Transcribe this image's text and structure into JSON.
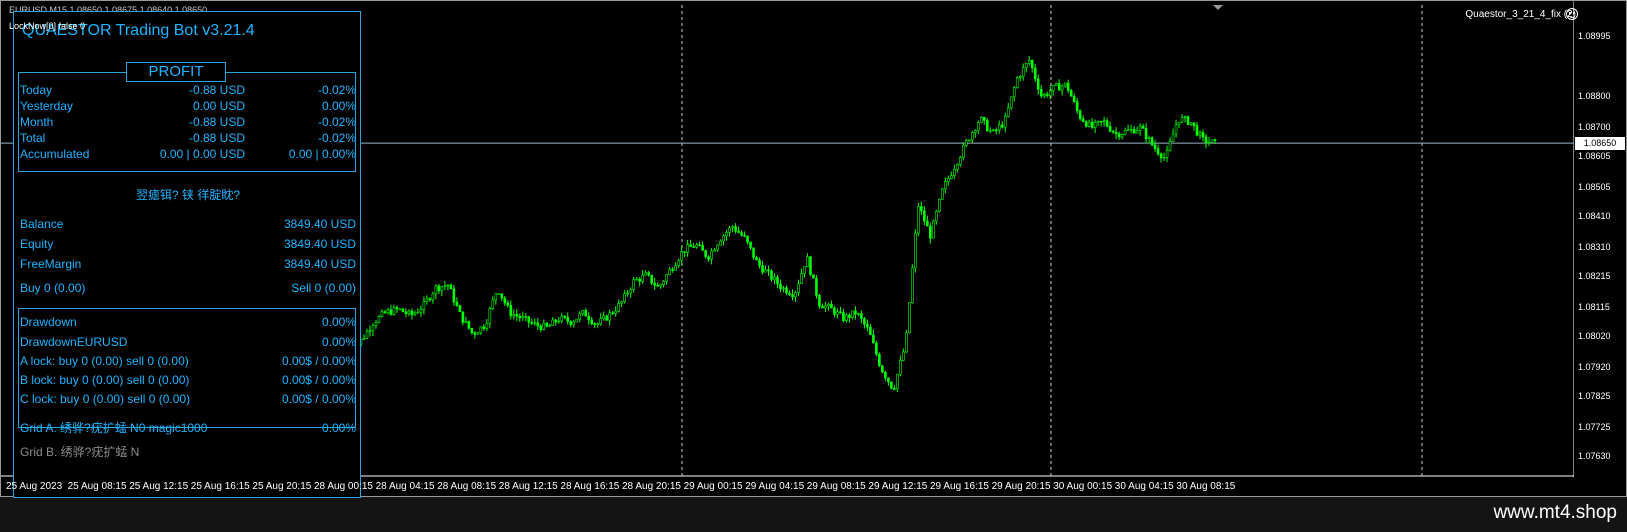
{
  "window": {
    "title_status": "EURUSD,M15 1.08650 1.08675 1.08640 1.08650",
    "lock_now": "LockNow[0] false 0",
    "expert": "Quaestor_3_21_4_fix (2)"
  },
  "panel": {
    "title": "QUAESTOR Trading Bot v3.21.4",
    "profit_header": "PROFIT",
    "profit_rows": [
      {
        "label": "Today",
        "usd": "-0.88 USD",
        "pct": "-0.02%"
      },
      {
        "label": "Yesterday",
        "usd": "0.00 USD",
        "pct": "0.00%"
      },
      {
        "label": "Month",
        "usd": "-0.88 USD",
        "pct": "-0.02%"
      },
      {
        "label": "Total",
        "usd": "-0.88 USD",
        "pct": "-0.02%"
      },
      {
        "label": "Accumulated",
        "usd": "0.00 | 0.00 USD",
        "pct": "0.00 | 0.00%"
      }
    ],
    "status_garbled": "翌瘧铒? 铗 徉腚眈?",
    "account_rows": [
      {
        "label": "Balance",
        "value": "3849.40 USD"
      },
      {
        "label": "Equity",
        "value": "3849.40 USD"
      },
      {
        "label": "FreeMargin",
        "value": "3849.40 USD"
      }
    ],
    "buy_label": "Buy 0   (0.00)",
    "sell_label": "Sell 0   (0.00)",
    "drawdown_rows": [
      {
        "label": "Drawdown",
        "value": "0.00%"
      },
      {
        "label": "DrawdownEURUSD",
        "value": "0.00%"
      },
      {
        "label": "A lock: buy 0 (0.00) sell 0 (0.00)",
        "value": "0.00$ / 0.00%"
      },
      {
        "label": "B lock: buy 0 (0.00) sell 0 (0.00)",
        "value": "0.00$ / 0.00%"
      },
      {
        "label": "C lock: buy 0 (0.00) sell 0 (0.00)",
        "value": "0.00$ / 0.00%"
      }
    ],
    "grid_a_label": "Grid A. 绣骅?疣扩蜢 N0 magic1000",
    "grid_a_value": "0.00%",
    "grid_b_label": "Grid B. 绣骅?疣扩蜢 N"
  },
  "chart_data": {
    "type": "candlestick",
    "symbol": "EURUSD",
    "timeframe": "M15",
    "y_ticks": [
      "1.08995",
      "1.08800",
      "1.08700",
      "1.08605",
      "1.08505",
      "1.08410",
      "1.08310",
      "1.08215",
      "1.08115",
      "1.08020",
      "1.07920",
      "1.07825",
      "1.07725",
      "1.07630"
    ],
    "current_price": "1.08650",
    "x_ticks": [
      "25 Aug 2023",
      "25 Aug 08:15",
      "25 Aug 12:15",
      "25 Aug 16:15",
      "25 Aug 20:15",
      "28 Aug 00:15",
      "28 Aug 04:15",
      "28 Aug 08:15",
      "28 Aug 12:15",
      "28 Aug 16:15",
      "28 Aug 20:15",
      "29 Aug 00:15",
      "29 Aug 04:15",
      "29 Aug 08:15",
      "29 Aug 12:15",
      "29 Aug 16:15",
      "29 Aug 20:15",
      "30 Aug 00:15",
      "30 Aug 04:15",
      "30 Aug 08:15"
    ],
    "close_path": [
      1.0797,
      1.0801,
      1.0807,
      1.081,
      1.0811,
      1.0809,
      1.0812,
      1.0818,
      1.0819,
      1.0809,
      1.0803,
      1.0806,
      1.0818,
      1.081,
      1.0808,
      1.0806,
      1.0805,
      1.0808,
      1.0807,
      1.081,
      1.0806,
      1.0809,
      1.0813,
      1.082,
      1.0822,
      1.0818,
      1.0824,
      1.083,
      1.0832,
      1.0828,
      1.0834,
      1.0838,
      1.0834,
      1.0826,
      1.0822,
      1.0818,
      1.0816,
      1.0828,
      1.0813,
      1.0811,
      1.0808,
      1.081,
      1.0804,
      1.0792,
      1.0785,
      1.08,
      1.0845,
      1.0835,
      1.085,
      1.0858,
      1.0866,
      1.0873,
      1.0868,
      1.0872,
      1.0886,
      1.0892,
      1.088,
      1.0883,
      1.0884,
      1.0874,
      1.087,
      1.0872,
      1.0868,
      1.0869,
      1.087,
      1.0864,
      1.086,
      1.0873,
      1.0872,
      1.0866,
      1.0865
    ],
    "vertical_gridlines": [
      "29 Aug 00:00",
      "30 Aug 00:00",
      "31 Aug 00:00"
    ],
    "colors": {
      "bull": "#00ff00",
      "bear": "#00ff00",
      "background": "#000000",
      "panel": "#1fb4ff"
    }
  },
  "watermark": "www.mt4.shop"
}
